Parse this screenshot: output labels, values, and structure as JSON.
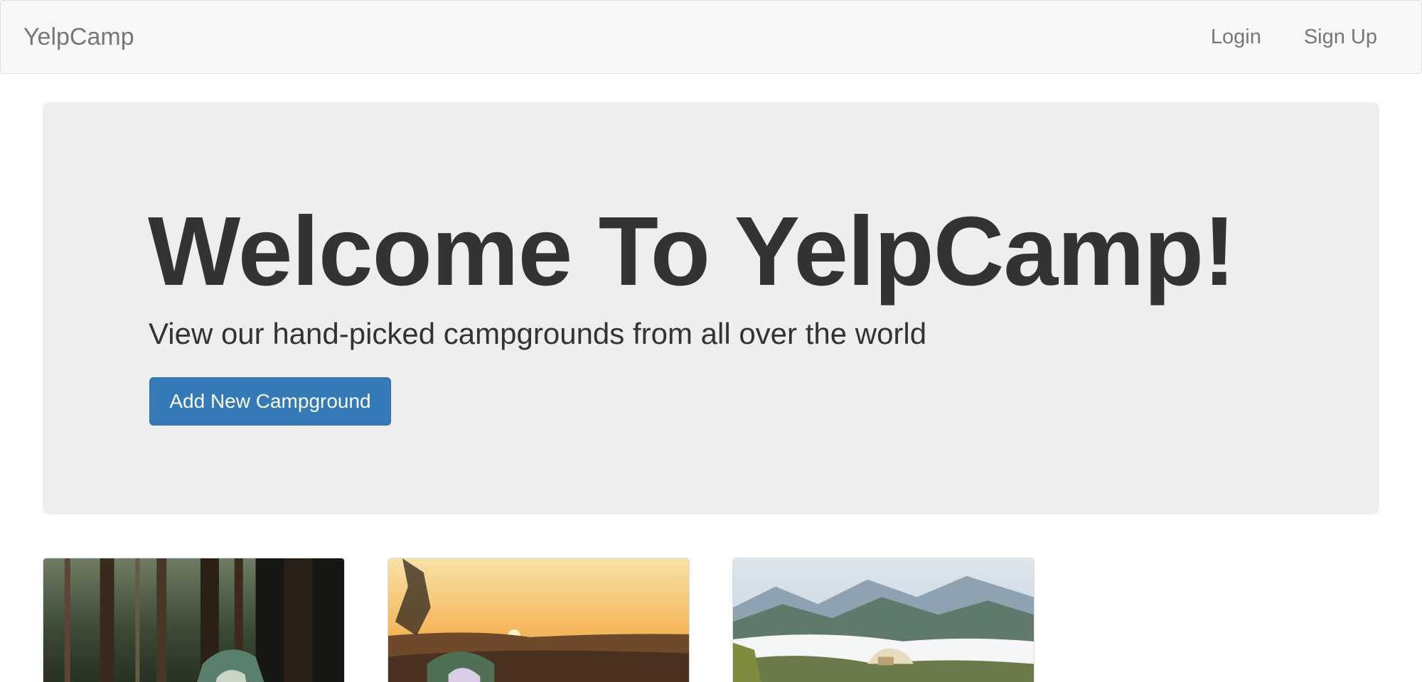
{
  "navbar": {
    "brand": "YelpCamp",
    "links": [
      {
        "label": "Login"
      },
      {
        "label": "Sign Up"
      }
    ]
  },
  "jumbotron": {
    "title": "Welcome To YelpCamp!",
    "subtitle": "View our hand-picked campgrounds from all over the world",
    "button_label": "Add New Campground"
  },
  "campgrounds": [
    {
      "image_scene": "forest-tent"
    },
    {
      "image_scene": "sunset-tent"
    },
    {
      "image_scene": "mountain-tent"
    }
  ],
  "colors": {
    "navbar_bg": "#f8f8f8",
    "jumbotron_bg": "#eeeeee",
    "primary": "#337ab7"
  }
}
